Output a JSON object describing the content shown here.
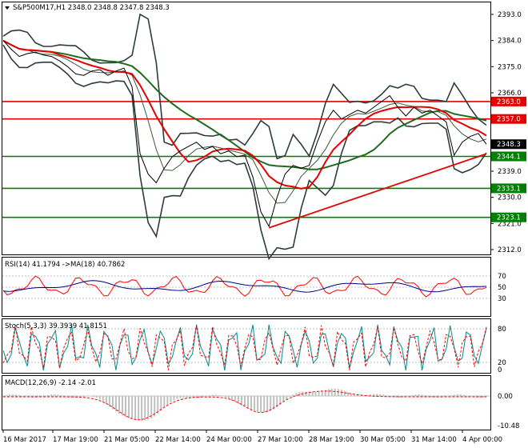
{
  "colors": {
    "background": "#ffffff",
    "frame": "#000000",
    "resistance": "#e60000",
    "support": "#008000",
    "trend": "#e60000",
    "ma_slow": "#1e6b1e",
    "ma_fast": "#e60000",
    "bands": "#2e3b3b",
    "price": "#000000",
    "rsi_line": "#ff0000",
    "rsi_ma": "#00008b",
    "stoch_main": "#008b8b",
    "stoch_signal": "#ff0000",
    "macd_hist": "#c0c0c0",
    "macd_signal": "#ff0000"
  },
  "main": {
    "title": "S&P500M17,H1  2348.0 2348.8 2347.8 2348.3",
    "menu_icon": "triangle-down-icon",
    "y_ticks": [
      "2393.0",
      "2384.0",
      "2375.0",
      "2366.0",
      "2357.0",
      "2348.0",
      "2339.0",
      "2330.0",
      "2321.0",
      "2312.0"
    ],
    "levels": [
      {
        "label": "2363.0",
        "value": 2363.0,
        "color": "#e60000"
      },
      {
        "label": "2357.0",
        "value": 2357.0,
        "color": "#e60000"
      },
      {
        "label": "2348.3",
        "value": 2348.3,
        "color": "#000000"
      },
      {
        "label": "2344.1",
        "value": 2344.1,
        "color": "#008000"
      },
      {
        "label": "2333.1",
        "value": 2333.1,
        "color": "#008000"
      },
      {
        "label": "2323.1",
        "value": 2323.1,
        "color": "#008000"
      }
    ]
  },
  "rsi": {
    "title": "RSI(14) 41.1794  ->MA(18) 40.7862",
    "ticks": [
      "70",
      "50",
      "30"
    ]
  },
  "stoch": {
    "title": "Stoch(5,3,3) 39.3939 41.8151",
    "ticks": [
      "80",
      "20",
      "0"
    ]
  },
  "macd": {
    "title": "MACD(12,26,9) -2.14 -2.01",
    "ticks": [
      "0.00",
      "-10.48"
    ]
  },
  "x_axis": [
    "16 Mar 2017",
    "17 Mar 19:00",
    "21 Mar 05:00",
    "22 Mar 14:00",
    "24 Mar 00:00",
    "27 Mar 10:00",
    "28 Mar 19:00",
    "30 Mar 05:00",
    "31 Mar 14:00",
    "4 Apr 00:00"
  ],
  "chart_data": {
    "type": "line",
    "title": "S&P500M17,H1",
    "x_labels": [
      "16 Mar 2017",
      "17 Mar 19:00",
      "21 Mar 05:00",
      "22 Mar 14:00",
      "24 Mar 00:00",
      "27 Mar 10:00",
      "28 Mar 19:00",
      "30 Mar 05:00",
      "31 Mar 14:00",
      "4 Apr 00:00"
    ],
    "ylim": [
      2312.0,
      2393.0
    ],
    "price_x": [
      0,
      10,
      20,
      30,
      40,
      50,
      60,
      70,
      80,
      90,
      100,
      110,
      120,
      130,
      140,
      150,
      160,
      170,
      180,
      190,
      200,
      210,
      220,
      230,
      240,
      250,
      260,
      270,
      280,
      290,
      300,
      310,
      320,
      330,
      340,
      350,
      360,
      370,
      380,
      390,
      400,
      410,
      420,
      430,
      440,
      450,
      460,
      470,
      480,
      490,
      500,
      510,
      520,
      530,
      540,
      550,
      560,
      570,
      580,
      590,
      600
    ],
    "price_close": [
      2384.0,
      2381.0,
      2378.5,
      2379.5,
      2380.0,
      2379.0,
      2378.5,
      2377.0,
      2375.0,
      2372.5,
      2372.0,
      2373.5,
      2374.0,
      2372.0,
      2373.5,
      2374.5,
      2368.0,
      2345.0,
      2338.0,
      2335.0,
      2340.0,
      2344.0,
      2346.0,
      2347.5,
      2349.0,
      2346.5,
      2347.5,
      2345.0,
      2346.0,
      2344.0,
      2344.5,
      2337.0,
      2325.0,
      2320.0,
      2330.0,
      2338.0,
      2341.0,
      2340.0,
      2341.0,
      2349.0,
      2356.0,
      2360.0,
      2357.0,
      2358.5,
      2360.0,
      2359.0,
      2361.0,
      2363.0,
      2365.0,
      2361.0,
      2358.0,
      2361.0,
      2359.0,
      2360.0,
      2358.0,
      2356.0,
      2344.5,
      2349.0,
      2351.0,
      2352.0,
      2348.3
    ],
    "series": [
      {
        "name": "RSI(14)",
        "last": 41.1794
      },
      {
        "name": "MA(18)",
        "last": 40.7862
      },
      {
        "name": "Stoch(5,3,3)",
        "values": [
          39.3939,
          41.8151
        ]
      },
      {
        "name": "MACD(12,26,9)",
        "values": [
          -2.14,
          -2.01
        ]
      }
    ],
    "rsi_levels": [
      70,
      50,
      30
    ],
    "stoch_levels": [
      80,
      20,
      0
    ],
    "macd_ylim": [
      -10.48,
      0.0
    ]
  }
}
